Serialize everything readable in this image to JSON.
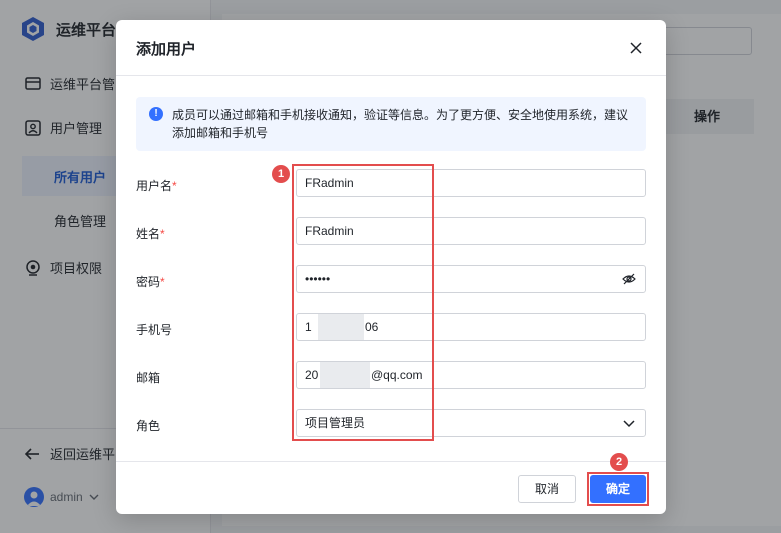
{
  "sidebar": {
    "brand": "运维平台",
    "items": [
      {
        "label": "运维平台管"
      },
      {
        "label": "用户管理"
      },
      {
        "label": "所有用户"
      },
      {
        "label": "角色管理"
      },
      {
        "label": "项目权限"
      }
    ],
    "back_label": "返回运维平",
    "user_name": "admin"
  },
  "background": {
    "table_op_header": "操作"
  },
  "modal": {
    "title": "添加用户",
    "notice": "成员可以通过邮箱和手机接收通知，验证等信息。为了更方便、安全地使用系统，建议添加邮箱和手机号",
    "fields": {
      "username": {
        "label": "用户名",
        "required_mark": "*",
        "value": "FRadmin"
      },
      "name": {
        "label": "姓名",
        "required_mark": "*",
        "value": "FRadmin"
      },
      "password": {
        "label": "密码",
        "required_mark": "*",
        "value": "••••••"
      },
      "phone": {
        "label": "手机号",
        "value_prefix": "1",
        "value_suffix": "06"
      },
      "email": {
        "label": "邮箱",
        "value_prefix": "20",
        "value_suffix": "@qq.com"
      },
      "role": {
        "label": "角色",
        "value": "项目管理员"
      }
    },
    "cancel_label": "取消",
    "ok_label": "确定",
    "badge_1": "1",
    "badge_2": "2"
  },
  "colors": {
    "primary": "#3370ff",
    "annotation_red": "#e34d4d",
    "required_red": "#f54a45"
  },
  "icons": [
    "brand-cube-icon",
    "monitor-icon",
    "user-manage-icon",
    "project-permission-icon",
    "arrow-left-icon",
    "chevron-down-icon",
    "info-icon",
    "close-icon",
    "eye-off-icon"
  ]
}
